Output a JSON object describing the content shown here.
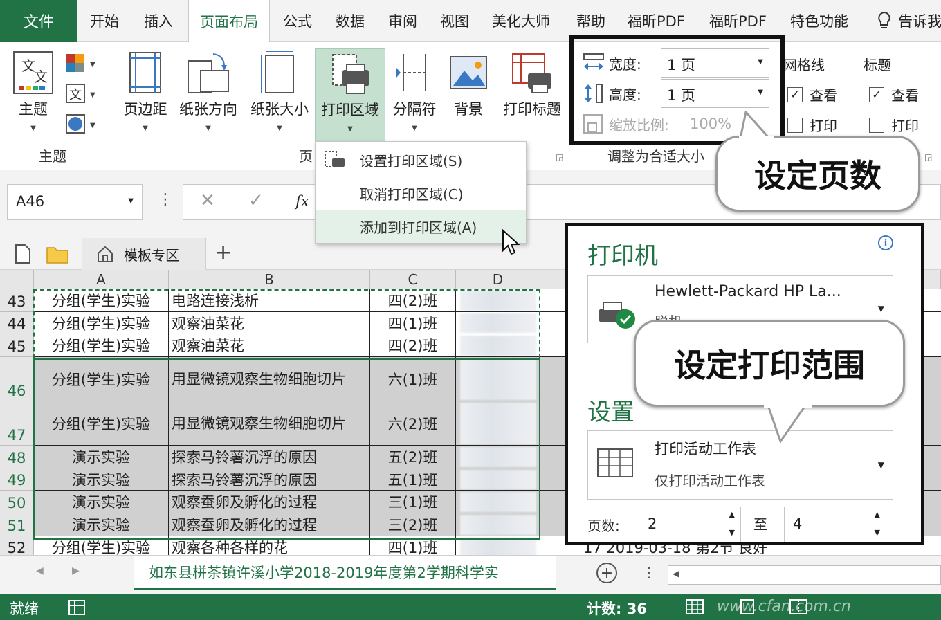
{
  "tabs": {
    "file": "文件",
    "items": [
      "开始",
      "插入",
      "页面布局",
      "公式",
      "数据",
      "审阅",
      "视图",
      "美化大师",
      "帮助",
      "福昕PDF",
      "福昕PDF",
      "特色功能",
      "告诉我"
    ],
    "active": "页面布局"
  },
  "ribbon": {
    "theme_btn": "主题",
    "theme_group": "主题",
    "margins": "页边距",
    "orientation": "纸张方向",
    "size": "纸张大小",
    "print_area": "打印区域",
    "breaks": "分隔符",
    "background": "背景",
    "print_titles": "打印标题",
    "page_setup_group": "页",
    "width_label": "宽度:",
    "width_value": "1 页",
    "height_label": "高度:",
    "height_value": "1 页",
    "scale_label": "缩放比例:",
    "scale_value": "100%",
    "fit_group": "调整为合适大小",
    "gridlines_title": "网格线",
    "gridlines_view": "查看",
    "gridlines_print": "打印",
    "headings_title": "标题",
    "headings_view": "查看",
    "headings_print": "打印"
  },
  "menu": {
    "set": "设置打印区域(S)",
    "clear": "取消打印区域(C)",
    "add": "添加到打印区域(A)"
  },
  "formula_bar": {
    "name_box": "A46",
    "fx": "fx"
  },
  "template_tab": "模板专区",
  "columns": [
    "A",
    "B",
    "C",
    "D"
  ],
  "rows": [
    {
      "n": "43",
      "a": "分组(学生)实验",
      "b": "电路连接浅析",
      "c": "四(2)班"
    },
    {
      "n": "44",
      "a": "分组(学生)实验",
      "b": "观察油菜花",
      "c": "四(1)班"
    },
    {
      "n": "45",
      "a": "分组(学生)实验",
      "b": "观察油菜花",
      "c": "四(2)班"
    },
    {
      "n": "46",
      "a": "分组(学生)实验",
      "b": "用显微镜观察生物细胞切片",
      "c": "六(1)班"
    },
    {
      "n": "47",
      "a": "分组(学生)实验",
      "b": "用显微镜观察生物细胞切片",
      "c": "六(2)班"
    },
    {
      "n": "48",
      "a": "演示实验",
      "b": "探索马铃薯沉浮的原因",
      "c": "五(2)班"
    },
    {
      "n": "49",
      "a": "演示实验",
      "b": "探索马铃薯沉浮的原因",
      "c": "五(1)班"
    },
    {
      "n": "50",
      "a": "演示实验",
      "b": "观察蚕卵及孵化的过程",
      "c": "三(1)班"
    },
    {
      "n": "51",
      "a": "演示实验",
      "b": "观察蚕卵及孵化的过程",
      "c": "三(2)班"
    },
    {
      "n": "52",
      "a": "分组(学生)实验",
      "b": "观察各种各样的花",
      "c": "四(1)班"
    }
  ],
  "behind_row": "17  2019-03-18 第2节 良好",
  "sheet_tab": "如东县栟茶镇许溪小学2018-2019年度第2学期科学实",
  "status": {
    "ready": "就绪",
    "count": "计数: 36",
    "watermark": "www.cfan.com.cn"
  },
  "print_panel": {
    "printer_title": "打印机",
    "printer_name": "Hewlett-Packard HP La...",
    "printer_status": "脱机",
    "settings_title": "设置",
    "setting_main": "打印活动工作表",
    "setting_sub": "仅打印活动工作表",
    "pages_label": "页数:",
    "pages_from": "2",
    "pages_to_label": "至",
    "pages_to": "4"
  },
  "callouts": {
    "pages": "设定页数",
    "range": "设定打印范围"
  },
  "colors": {
    "accent": "#217346",
    "selection_gray": "#d0d0d0",
    "menu_highlight": "#e3f1e8"
  }
}
